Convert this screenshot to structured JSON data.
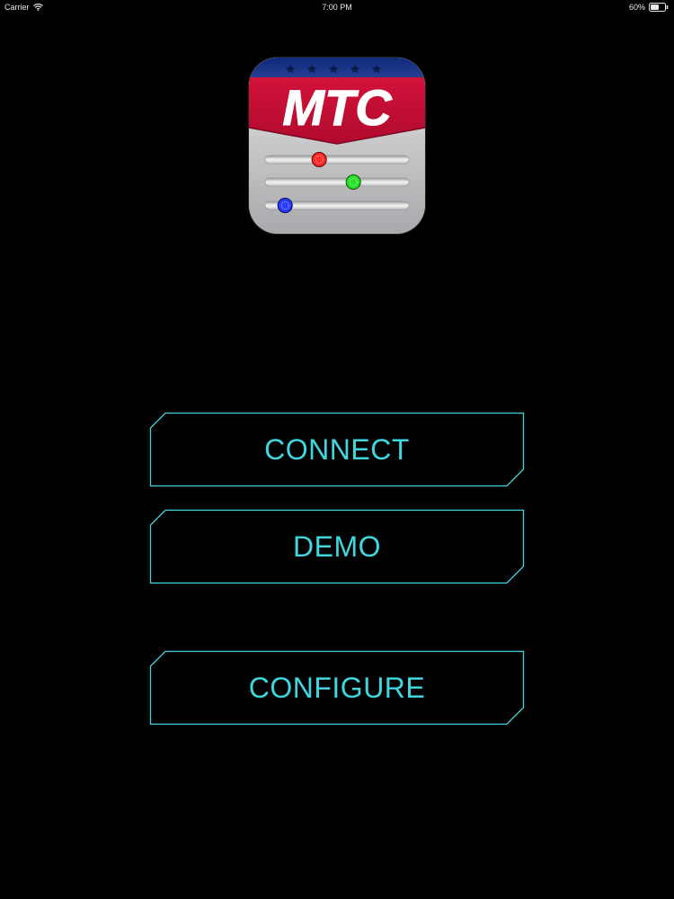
{
  "status_bar": {
    "carrier": "Carrier",
    "time": "7:00 PM",
    "battery": "60%",
    "battery_level": 0.6
  },
  "app_icon": {
    "brand_text": "MTC",
    "icon": "mtc-app-icon",
    "slider_colors": [
      "#ff2a2a",
      "#2adf2a",
      "#2a3dff"
    ],
    "slider_levels": [
      0.37,
      0.62,
      0.12
    ]
  },
  "buttons": {
    "connect_label": "CONNECT",
    "demo_label": "DEMO",
    "configure_label": "CONFIGURE"
  },
  "colors": {
    "background": "#000000",
    "accent": "#3fd6dd"
  }
}
